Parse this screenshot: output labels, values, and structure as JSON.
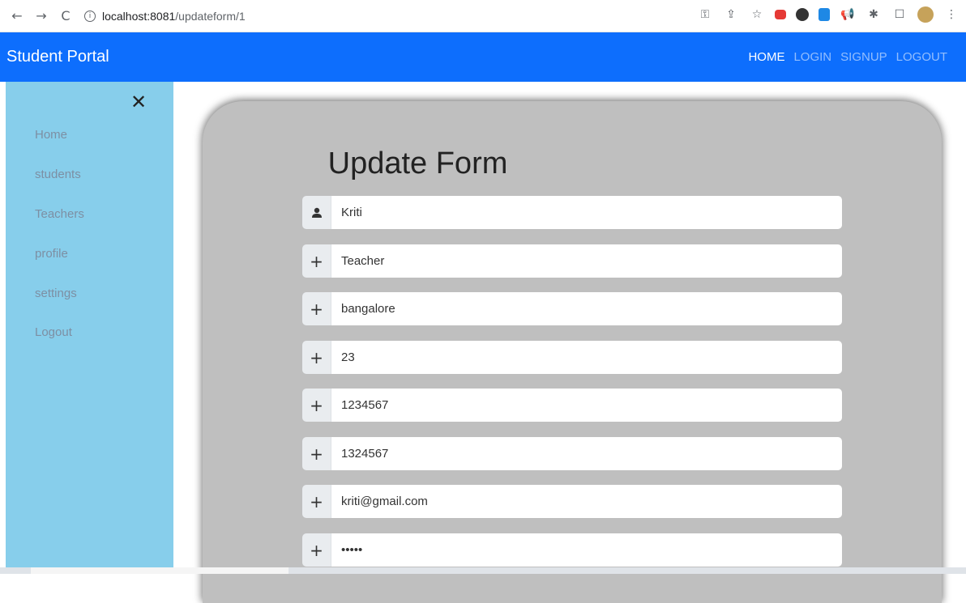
{
  "browser": {
    "back_icon": "←",
    "forward_icon": "→",
    "reload_icon": "C",
    "url_host": "localhost:8081",
    "url_path": "/updateform/1"
  },
  "navbar": {
    "brand": "Student Portal",
    "links": [
      "HOME",
      "LOGIN",
      "SIGNUP",
      "LOGOUT"
    ]
  },
  "sidebar": {
    "close_icon": "✕",
    "items": [
      "Home",
      "students",
      "Teachers",
      "profile",
      "settings",
      "Logout"
    ]
  },
  "form": {
    "title": "Update Form",
    "fields": [
      {
        "icon": "person-icon",
        "value": "Kriti"
      },
      {
        "icon": "plus-icon",
        "value": "Teacher"
      },
      {
        "icon": "plus-icon",
        "value": "bangalore"
      },
      {
        "icon": "plus-icon",
        "value": "23"
      },
      {
        "icon": "plus-icon",
        "value": "1234567"
      },
      {
        "icon": "plus-icon",
        "value": "1324567"
      },
      {
        "icon": "plus-icon",
        "value": "kriti@gmail.com"
      },
      {
        "icon": "plus-icon",
        "value": "•••••"
      }
    ]
  },
  "colors": {
    "navbar": "#0d6efd",
    "sidebar": "#87ceeb",
    "card": "#bfbfbf"
  }
}
